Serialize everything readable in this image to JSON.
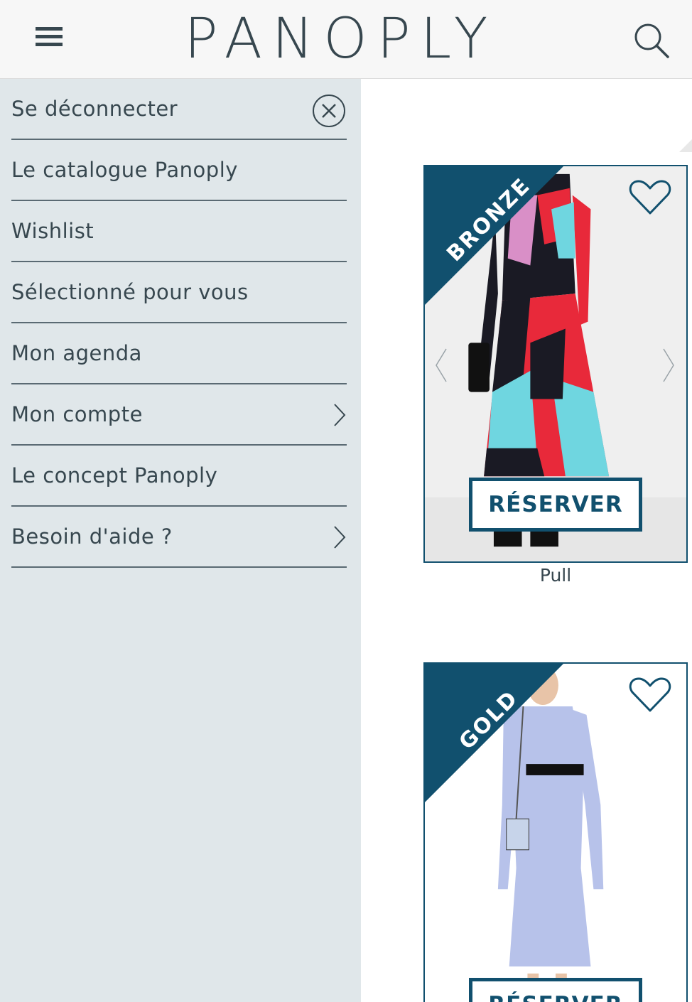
{
  "header": {
    "logo": "PANOPLY",
    "menu_icon": "hamburger-menu-icon",
    "search_icon": "search-icon"
  },
  "drawer": {
    "items": [
      {
        "label": "Se déconnecter",
        "trailing": "close-circle-icon"
      },
      {
        "label": "Le catalogue Panoply",
        "trailing": null
      },
      {
        "label": "Wishlist",
        "trailing": null
      },
      {
        "label": "Sélectionné pour vous",
        "trailing": null
      },
      {
        "label": "Mon agenda",
        "trailing": null
      },
      {
        "label": "Mon compte",
        "trailing": "chevron-right-icon"
      },
      {
        "label": "Le concept Panoply",
        "trailing": null
      },
      {
        "label": "Besoin d'aide ?",
        "trailing": "chevron-right-icon"
      }
    ]
  },
  "products": [
    {
      "badge": "BRONZE",
      "button_label": "RÉSERVER",
      "caption": "Pull"
    },
    {
      "badge": "GOLD",
      "button_label": "RÉSERVER",
      "caption": ""
    }
  ],
  "colors": {
    "brand_dark": "#11506e",
    "text": "#37474f",
    "drawer_bg": "#e0e7ea",
    "header_bg": "#f7f7f7"
  }
}
